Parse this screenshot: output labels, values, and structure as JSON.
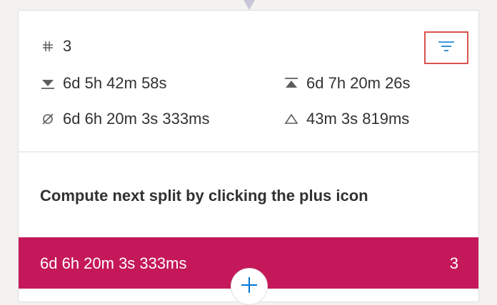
{
  "stats": {
    "count_icon": "tally-icon",
    "count": "3",
    "min_icon": "min-icon",
    "min": "6d 5h 42m 58s",
    "max_icon": "max-icon",
    "max": "6d 7h 20m 26s",
    "avg_icon": "average-icon",
    "avg": "6d 6h 20m 3s 333ms",
    "delta_icon": "delta-icon",
    "delta": "43m 3s 819ms",
    "filter_icon": "filter-icon"
  },
  "hint": "Compute next split by clicking the plus icon",
  "split": {
    "value": "6d 6h 20m 3s 333ms",
    "count": "3",
    "color": "#c4185a"
  },
  "add_button": {
    "icon": "plus-icon"
  },
  "colors": {
    "accent": "#0078d4",
    "highlight_border": "#d9534f"
  }
}
